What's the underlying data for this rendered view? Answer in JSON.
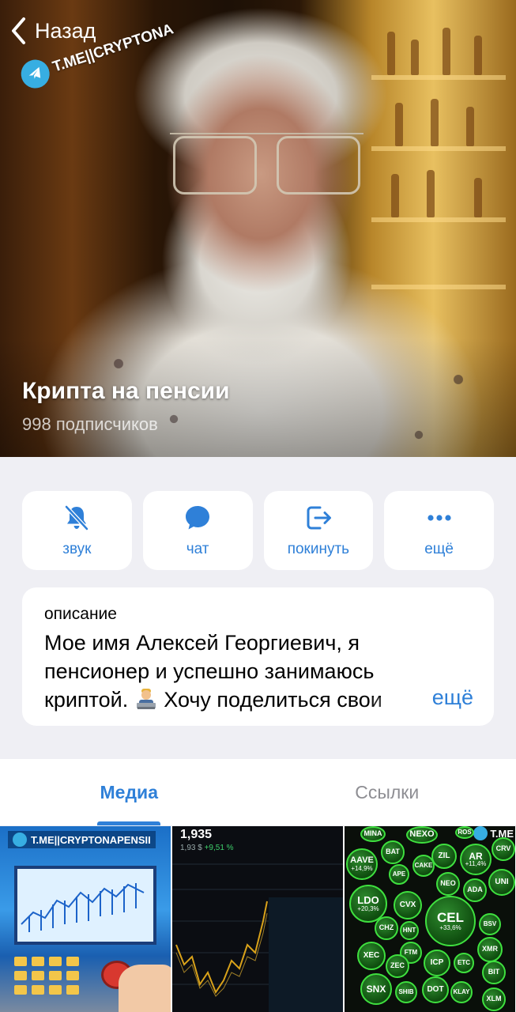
{
  "header": {
    "back_label": "Назад",
    "watermark": "T.ME||CRYPTONA",
    "channel_title": "Крипта на пенсии",
    "subscribers": "998 подписчиков"
  },
  "actions": [
    {
      "label": "звук",
      "icon": "bell-slash-icon"
    },
    {
      "label": "чат",
      "icon": "chat-bubble-icon"
    },
    {
      "label": "покинуть",
      "icon": "leave-icon"
    },
    {
      "label": "ещё",
      "icon": "more-dots-icon"
    }
  ],
  "description": {
    "caption": "описание",
    "line1": "Мое имя Алексей Георгиевич, я",
    "line2": "пенсионер и успешно занимаюсь",
    "line3_a": "криптой.",
    "line3_b": "Хочу поделиться свои",
    "more_label": "ещё"
  },
  "tabs": {
    "media": "Медиа",
    "links": "Ссылки"
  },
  "media": {
    "thumb1_watermark": "T.ME||CRYPTONAPENSII",
    "thumb2_price": "1,935",
    "thumb2_change_a": "1,93 $",
    "thumb2_change_b": "+9,51 %",
    "thumb3_watermark": "T.ME",
    "bubbles": [
      {
        "name": "MINA"
      },
      {
        "name": "NEXO"
      },
      {
        "name": "ROS"
      },
      {
        "name": "AAVE",
        "change": "+14,9%"
      },
      {
        "name": "BAT"
      },
      {
        "name": "ZIL"
      },
      {
        "name": "AR",
        "change": "+11,4%"
      },
      {
        "name": "CRV"
      },
      {
        "name": "APE"
      },
      {
        "name": "CAKE"
      },
      {
        "name": "LDO",
        "change": "+20,3%"
      },
      {
        "name": "NEO"
      },
      {
        "name": "ADA"
      },
      {
        "name": "UNI"
      },
      {
        "name": "CVX"
      },
      {
        "name": "CEL",
        "change": "+33,6%"
      },
      {
        "name": "CHZ"
      },
      {
        "name": "HNT"
      },
      {
        "name": "FTM"
      },
      {
        "name": "BSV"
      },
      {
        "name": "XEC"
      },
      {
        "name": "XMR"
      },
      {
        "name": "ZEC"
      },
      {
        "name": "ICP"
      },
      {
        "name": "ETC"
      },
      {
        "name": "BIT"
      },
      {
        "name": "SNX"
      },
      {
        "name": "SHIB"
      },
      {
        "name": "DOT"
      },
      {
        "name": "KLAY"
      },
      {
        "name": "XLM"
      }
    ]
  },
  "colors": {
    "accent": "#2f80d8",
    "background": "#efeff4",
    "card": "#ffffff",
    "telegram_blue": "#37aee2"
  }
}
